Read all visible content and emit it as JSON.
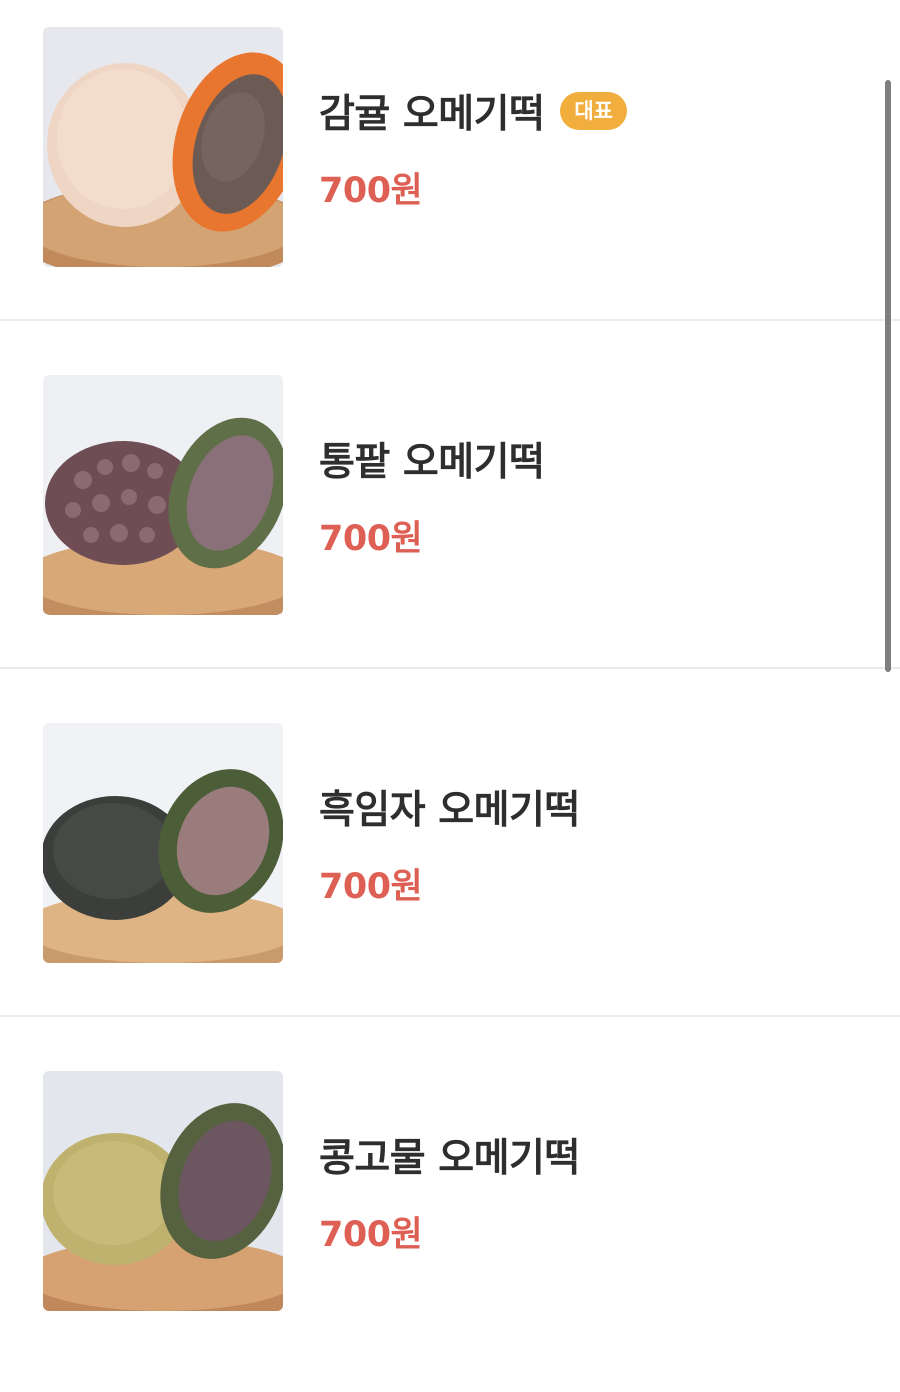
{
  "menu": {
    "items": [
      {
        "name": "감귤 오메기떡",
        "badge": "대표",
        "price": "700원",
        "image_icon": "tangerine-omegi-rice-cake-photo"
      },
      {
        "name": "통팥 오메기떡",
        "price": "700원",
        "image_icon": "red-bean-omegi-rice-cake-photo"
      },
      {
        "name": "흑임자 오메기떡",
        "price": "700원",
        "image_icon": "black-sesame-omegi-rice-cake-photo"
      },
      {
        "name": "콩고물 오메기떡",
        "price": "700원",
        "image_icon": "soybean-powder-omegi-rice-cake-photo"
      }
    ]
  },
  "colors": {
    "price": "#de5f53",
    "badge": "#f2ae3d",
    "title": "#2e2e2e",
    "divider": "#ececec",
    "scrollbar": "#7f7f7f"
  }
}
